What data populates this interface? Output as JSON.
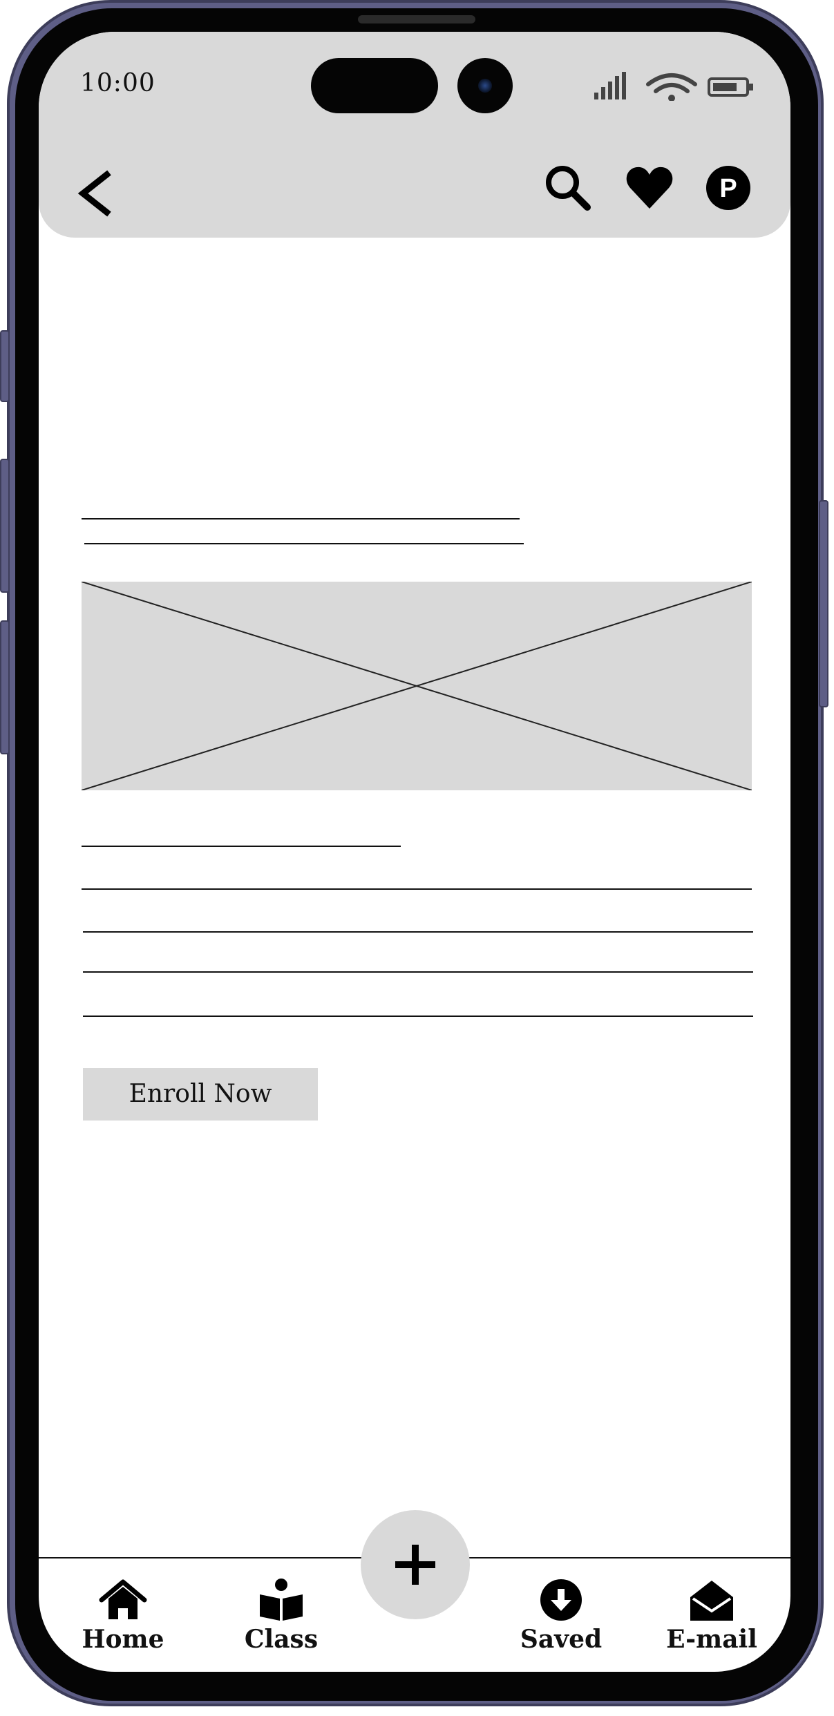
{
  "status_bar": {
    "time": "10:00"
  },
  "header": {
    "back_icon": "chevron-left-icon",
    "search_icon": "search-icon",
    "favorite_icon": "heart-icon",
    "profile_icon": "profile-p-icon",
    "profile_letter": "P"
  },
  "content": {
    "image_placeholder": "image-placeholder",
    "enroll_label": "Enroll Now"
  },
  "tabbar": {
    "fab_icon": "plus-icon",
    "tabs": [
      {
        "label": "Home",
        "icon": "home-icon"
      },
      {
        "label": "Class",
        "icon": "reading-person-icon"
      },
      {
        "label": "Saved",
        "icon": "download-circle-icon"
      },
      {
        "label": "E-mail",
        "icon": "open-envelope-icon"
      }
    ]
  },
  "colors": {
    "frame": "#5e5e86",
    "bezel": "#050505",
    "surface": "#d9d9d9",
    "ink": "#111111",
    "background": "#ffffff"
  }
}
